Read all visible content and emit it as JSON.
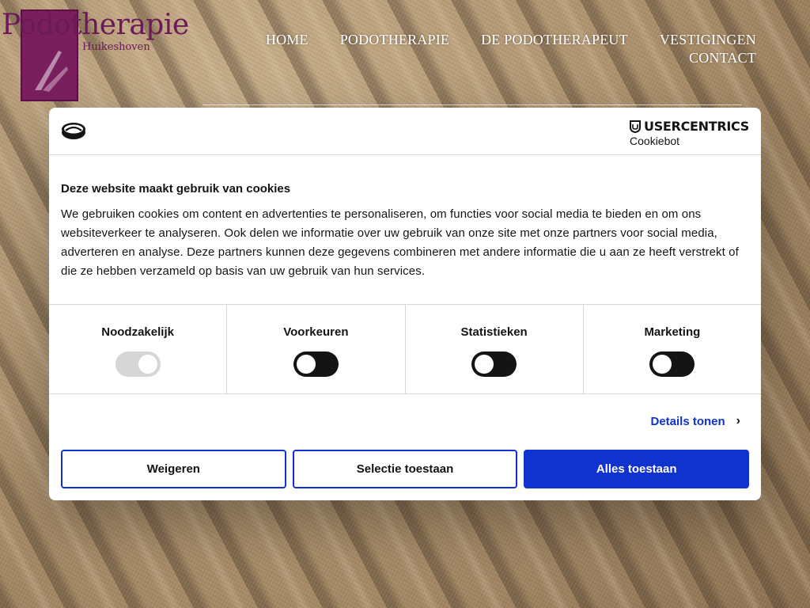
{
  "site": {
    "logo_title": "Podotherapie",
    "logo_subtitle": "Huikeshoven",
    "nav": [
      "HOME",
      "PODOTHERAPIE",
      "DE PODOTHERAPEUT",
      "VESTIGINGEN",
      "CONTACT"
    ]
  },
  "cookie_dialog": {
    "brand_name": "USERCENTRICS",
    "brand_sub": "Cookiebot",
    "title": "Deze website maakt gebruik van cookies",
    "text": "We gebruiken cookies om content en advertenties te personaliseren, om functies voor social media te bieden en om ons websiteverkeer te analyseren. Ook delen we informatie over uw gebruik van onze site met onze partners voor social media, adverteren en analyse. Deze partners kunnen deze gegevens combineren met andere informatie die u aan ze heeft verstrekt of die ze hebben verzameld op basis van uw gebruik van hun services.",
    "categories": [
      {
        "label": "Noodzakelijk",
        "enabled": true,
        "locked": true
      },
      {
        "label": "Voorkeuren",
        "enabled": false,
        "locked": false
      },
      {
        "label": "Statistieken",
        "enabled": false,
        "locked": false
      },
      {
        "label": "Marketing",
        "enabled": false,
        "locked": false
      }
    ],
    "details_link": "Details tonen",
    "buttons": {
      "deny": "Weigeren",
      "selection": "Selectie toestaan",
      "allow_all": "Alles toestaan"
    },
    "colors": {
      "accent": "#1032cf",
      "toggle_off": "#141414",
      "toggle_locked": "#d6d6d6"
    }
  },
  "icons": [
    "cookie-icon",
    "usercentrics-shield-icon",
    "chevron-right-icon"
  ]
}
